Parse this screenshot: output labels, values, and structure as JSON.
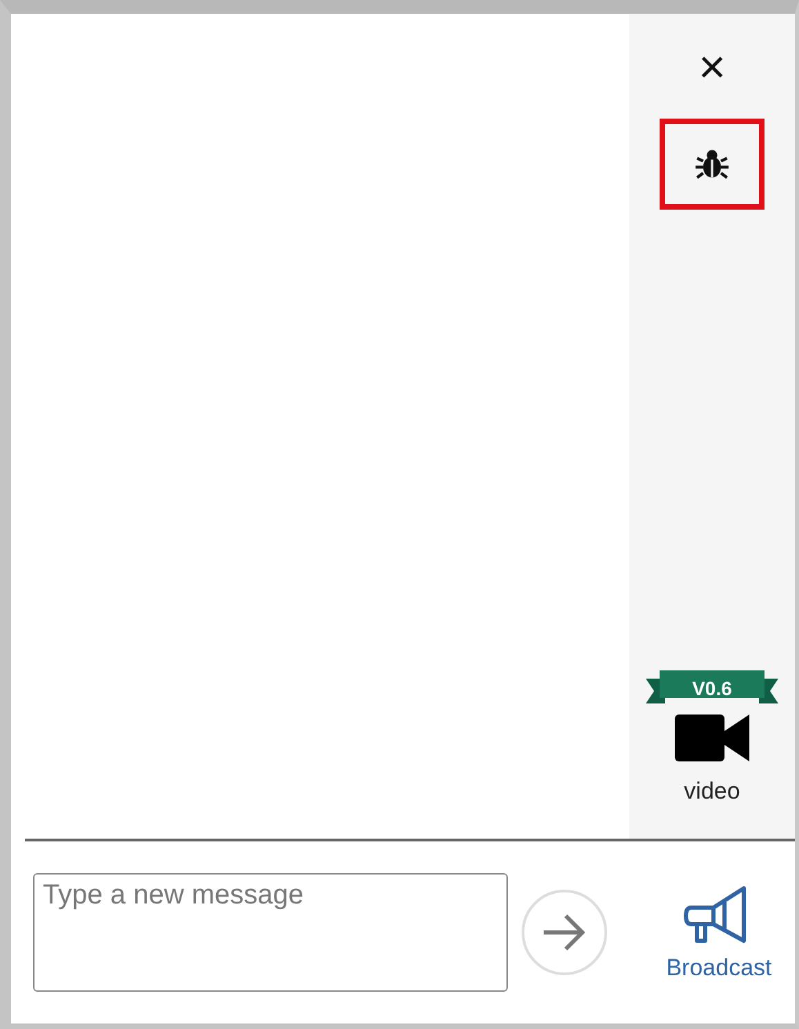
{
  "sidebar": {
    "close": {
      "label": "×"
    },
    "debug": {
      "highlighted": true
    },
    "video": {
      "badge": "V0.6",
      "label": "video"
    }
  },
  "composer": {
    "placeholder": "Type a new message",
    "broadcast": {
      "label": "Broadcast"
    }
  }
}
